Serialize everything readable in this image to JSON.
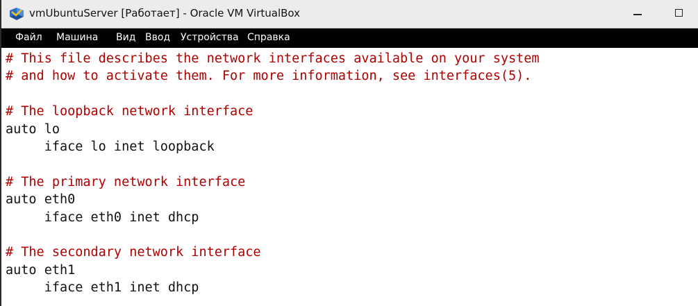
{
  "window": {
    "title": "vmUbuntuServer [Работает] - Oracle VM VirtualBox",
    "app_icon": "virtualbox-icon",
    "controls": {
      "minimize_icon": "minimize-icon",
      "maximize_icon": "maximize-icon"
    }
  },
  "menubar": {
    "items": [
      {
        "label": "Файл"
      },
      {
        "label": "Машина"
      },
      {
        "label": "Вид"
      },
      {
        "label": "Ввод"
      },
      {
        "label": "Устройства"
      },
      {
        "label": "Справка"
      }
    ]
  },
  "console": {
    "comment_color": "#b00000",
    "text_color": "#111111",
    "lines": [
      {
        "text": "# This file describes the network interfaces available on your system",
        "kind": "comment"
      },
      {
        "text": "# and how to activate them. For more information, see interfaces(5).",
        "kind": "comment"
      },
      {
        "text": "",
        "kind": "blank"
      },
      {
        "text": "# The loopback network interface",
        "kind": "comment"
      },
      {
        "text": "auto lo",
        "kind": "plain"
      },
      {
        "text": "     iface lo inet loopback",
        "kind": "plain"
      },
      {
        "text": "",
        "kind": "blank"
      },
      {
        "text": "# The primary network interface",
        "kind": "comment"
      },
      {
        "text": "auto eth0",
        "kind": "plain"
      },
      {
        "text": "     iface eth0 inet dhcp",
        "kind": "plain"
      },
      {
        "text": "",
        "kind": "blank"
      },
      {
        "text": "# The secondary network interface",
        "kind": "comment"
      },
      {
        "text": "auto eth1",
        "kind": "plain"
      },
      {
        "text": "     iface eth1 inet dhcp",
        "kind": "plain"
      }
    ]
  }
}
